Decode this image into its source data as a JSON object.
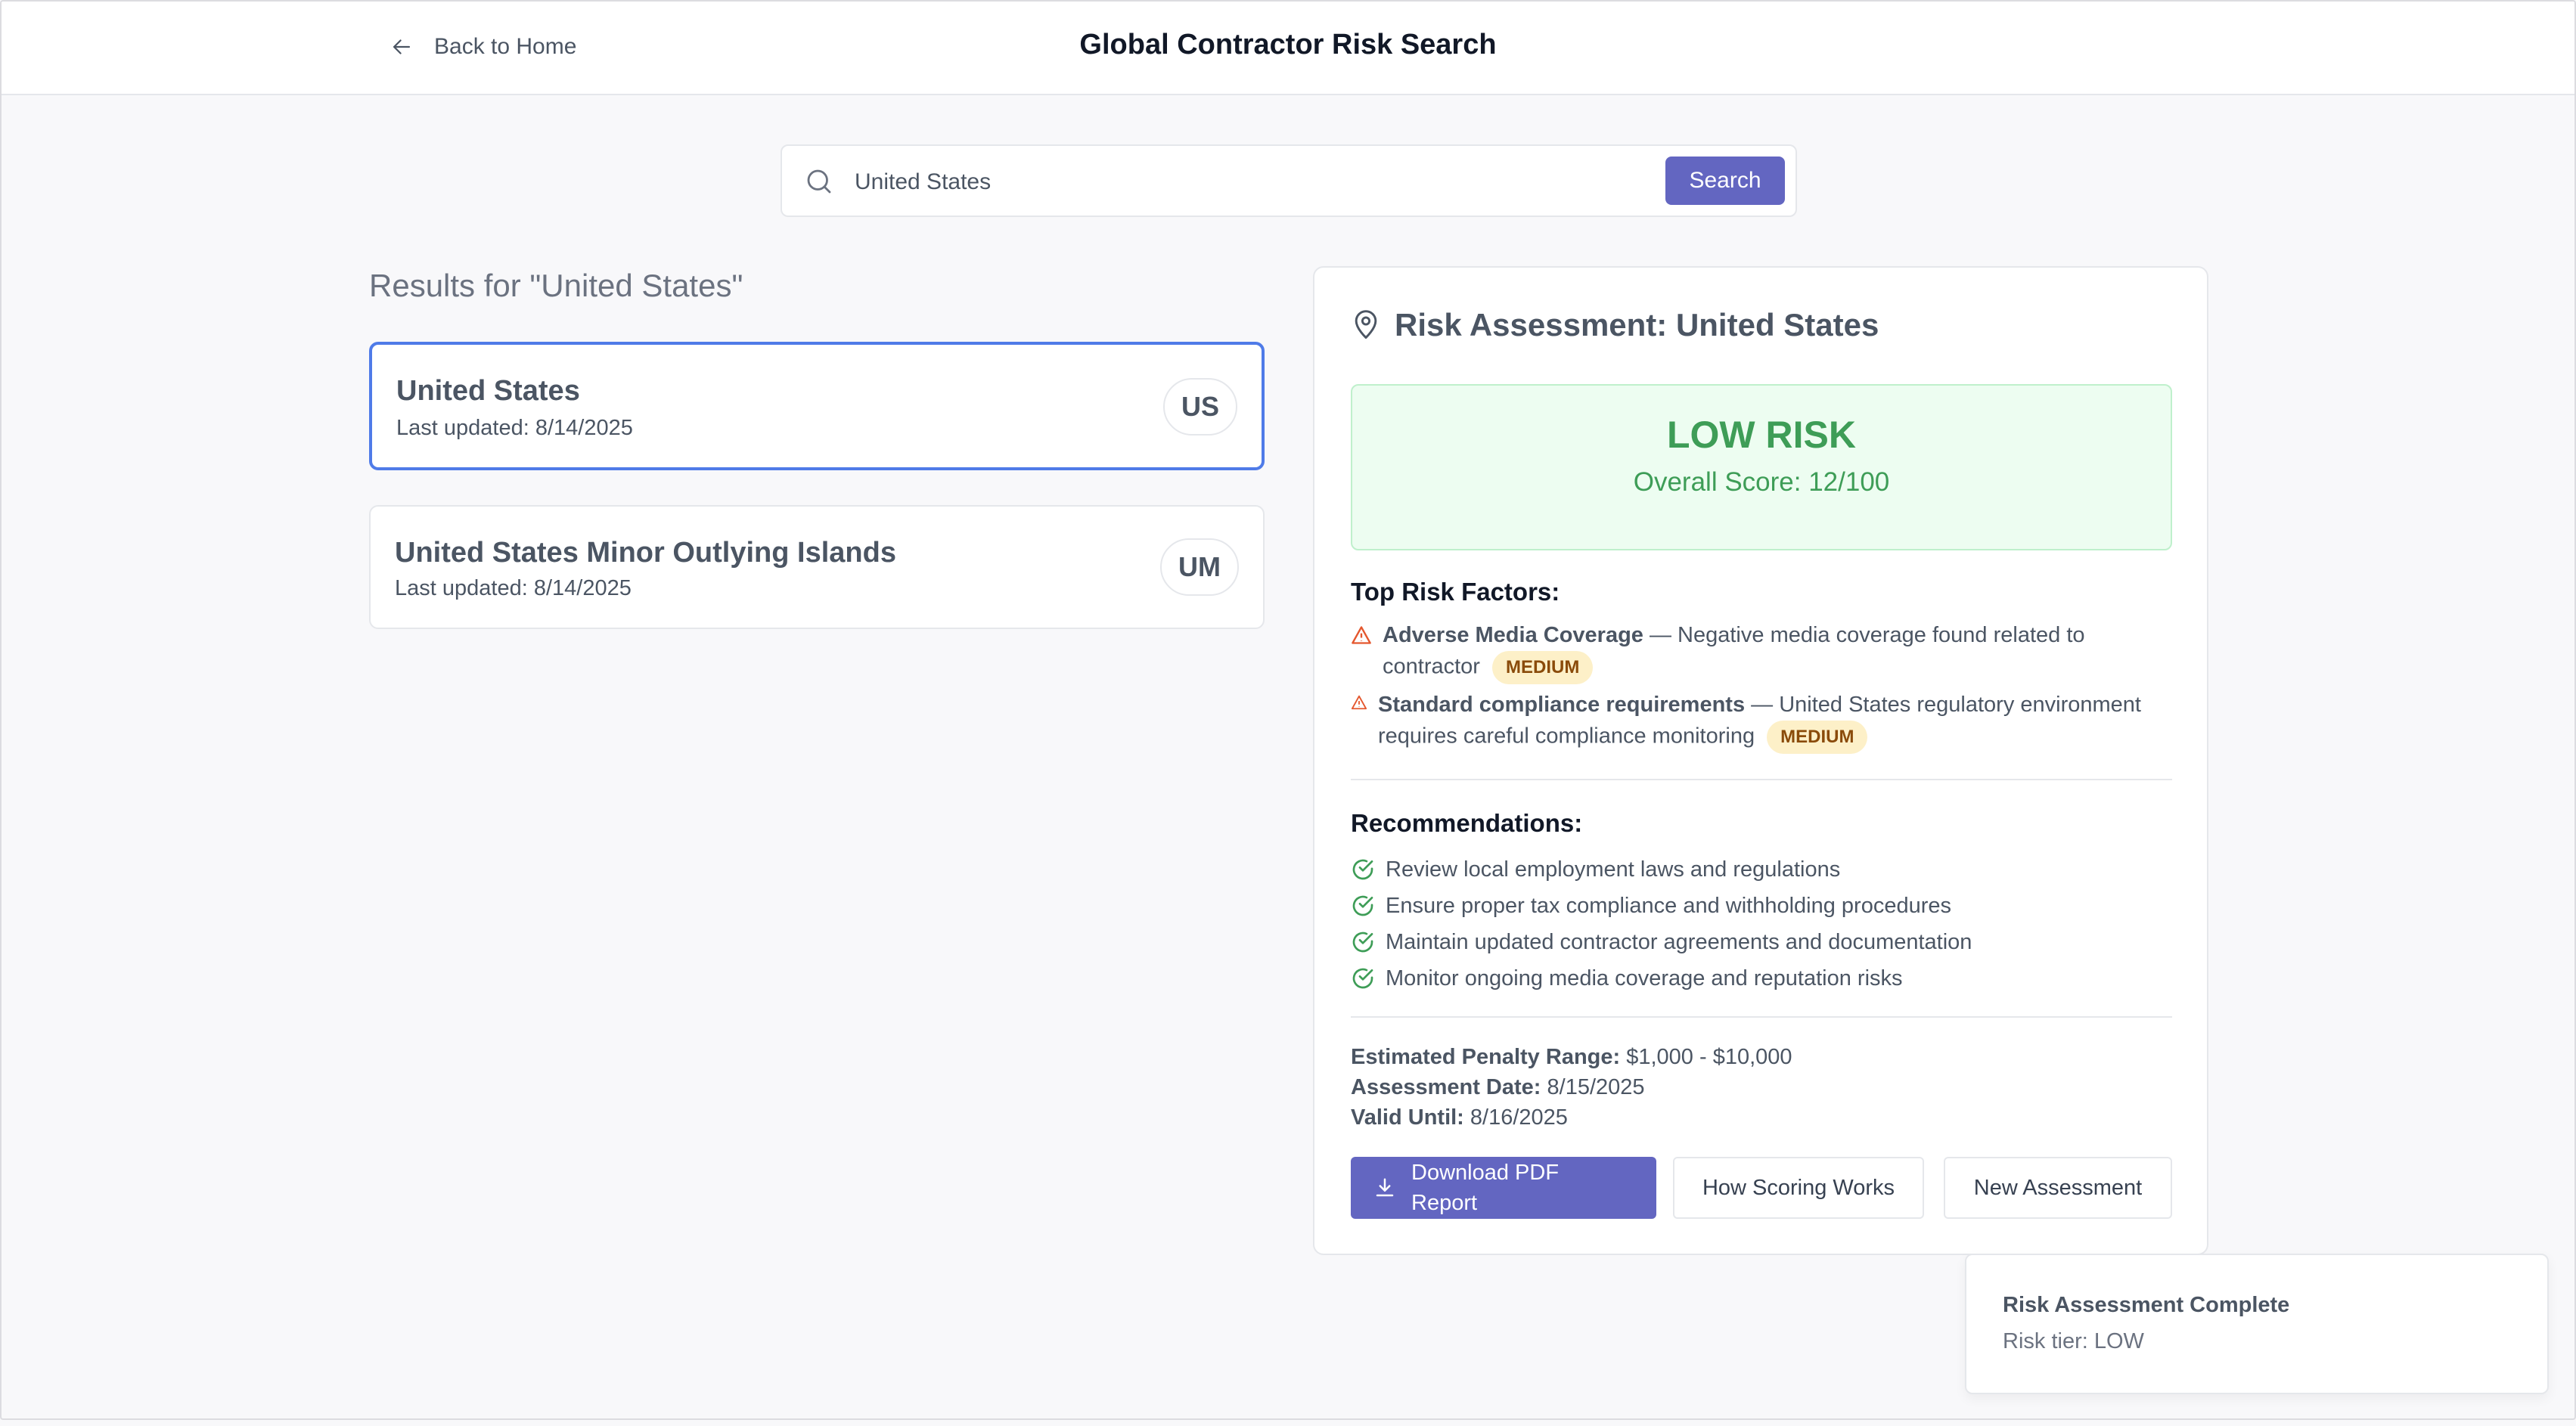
{
  "header": {
    "back_label": "Back to Home",
    "title": "Global Contractor Risk Search"
  },
  "search": {
    "value": "United States",
    "button_label": "Search"
  },
  "results": {
    "title": "Results for \"United States\"",
    "items": [
      {
        "name": "United States",
        "updated": "Last updated: 8/14/2025",
        "code": "US",
        "selected": true
      },
      {
        "name": "United States Minor Outlying Islands",
        "updated": "Last updated: 8/14/2025",
        "code": "UM",
        "selected": false
      }
    ]
  },
  "assessment": {
    "title": "Risk Assessment: United States",
    "risk_level": "LOW RISK",
    "score_text": "Overall Score: 12/100",
    "factors_title": "Top Risk Factors:",
    "factors": [
      {
        "name": "Adverse Media Coverage",
        "desc": " — Negative media coverage found related to contractor",
        "severity": "MEDIUM"
      },
      {
        "name": "Standard compliance requirements",
        "desc": " — United States regulatory environment requires careful compliance monitoring",
        "severity": "MEDIUM"
      }
    ],
    "recommendations_title": "Recommendations:",
    "recommendations": [
      "Review local employment laws and regulations",
      "Ensure proper tax compliance and withholding procedures",
      "Maintain updated contractor agreements and documentation",
      "Monitor ongoing media coverage and reputation risks"
    ],
    "penalty_label": "Estimated Penalty Range:",
    "penalty_value": "$1,000 - $10,000",
    "date_label": "Assessment Date:",
    "date_value": "8/15/2025",
    "valid_label": "Valid Until:",
    "valid_value": "8/16/2025",
    "download_label": "Download PDF Report",
    "how_label": "How Scoring Works",
    "new_label": "New Assessment"
  },
  "toast": {
    "title": "Risk Assessment Complete",
    "message": "Risk tier: LOW"
  },
  "colors": {
    "accent": "#6366c1",
    "low_risk": "#3e9d57",
    "warning": "#e4572e",
    "success": "#3e9d57",
    "selected_border": "#4f7be8"
  }
}
